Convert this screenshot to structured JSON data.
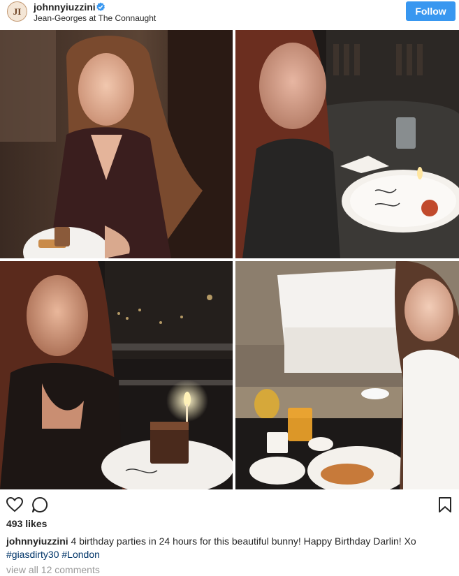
{
  "post": {
    "username": "johnnyiuzzini",
    "avatar_text": "JI",
    "location": "Jean-Georges at The Connaught",
    "follow_label": "Follow",
    "likes": "493 likes",
    "caption_user": "johnnyiuzzini",
    "caption_text": "4 birthday parties in 24 hours for this beautiful bunny! Happy Birthday Darlin! Xo",
    "hashtags": [
      "#giasdirty30",
      "#London"
    ],
    "comments_link": "view all 12 comments"
  },
  "colors": {
    "accent": "#3897f0",
    "hashtag": "#003569",
    "muted": "#999999",
    "verified": "#3897f0"
  },
  "icons": {
    "like": "heart-icon",
    "comment": "comment-icon",
    "save": "bookmark-icon",
    "verified": "verified-badge-icon"
  }
}
